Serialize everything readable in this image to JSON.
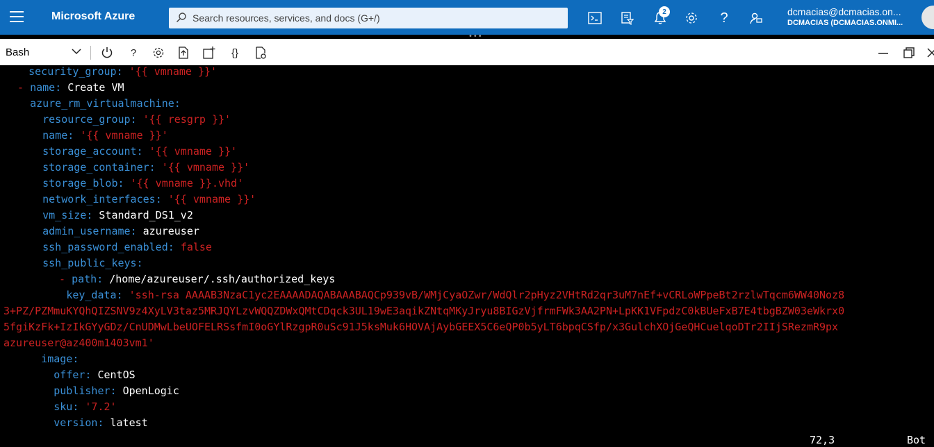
{
  "header": {
    "brand": "Microsoft Azure",
    "search_placeholder": "Search resources, services, and docs (G+/)",
    "notification_count": "2",
    "account_email": "dcmacias@dcmacias.on...",
    "account_directory": "DCMACIAS (DCMACIAS.ONMI..."
  },
  "shell": {
    "type": "Bash",
    "tools": {
      "help": "?",
      "braces": "{}"
    }
  },
  "terminal": {
    "l0": {
      "indent": "    ",
      "key": "security_group",
      "sep": ": ",
      "val": "'{{ vmname }}'"
    },
    "l1": {
      "dash": "- ",
      "key": "name",
      "sep": ": ",
      "val": "Create VM"
    },
    "l2": {
      "indent": "  ",
      "key": "azure_rm_virtualmachine",
      "sep": ":"
    },
    "l3": {
      "indent": "    ",
      "key": "resource_group",
      "sep": ": ",
      "val": "'{{ resgrp }}'"
    },
    "l4": {
      "indent": "    ",
      "key": "name",
      "sep": ": ",
      "val": "'{{ vmname }}'"
    },
    "l5": {
      "indent": "    ",
      "key": "storage_account",
      "sep": ": ",
      "val": "'{{ vmname }}'"
    },
    "l6": {
      "indent": "    ",
      "key": "storage_container",
      "sep": ": ",
      "val": "'{{ vmname }}'"
    },
    "l7": {
      "indent": "    ",
      "key": "storage_blob",
      "sep": ": ",
      "val": "'{{ vmname }}.vhd'"
    },
    "l8": {
      "indent": "    ",
      "key": "network_interfaces",
      "sep": ": ",
      "val": "'{{ vmname }}'"
    },
    "l9": {
      "indent": "    ",
      "key": "vm_size",
      "sep": ": ",
      "val": "Standard_DS1_v2"
    },
    "l10": {
      "indent": "    ",
      "key": "admin_username",
      "sep": ": ",
      "val": "azureuser"
    },
    "l11": {
      "indent": "    ",
      "key": "ssh_password_enabled",
      "sep": ": ",
      "val": "false"
    },
    "l12": {
      "indent": "    ",
      "key": "ssh_public_keys",
      "sep": ":"
    },
    "l13": {
      "dash": "- ",
      "key": "path",
      "sep": ": ",
      "val": "/home/azureuser/.ssh/authorized_keys"
    },
    "l14": {
      "indent": "          ",
      "key": "key_data",
      "sep": ": ",
      "val": "'ssh-rsa AAAAB3NzaC1yc2EAAAADAQABAAABAQCp939vB/WMjCyaOZwr/WdQlr2pHyz2VHtRd2qr3uM7nEf+vCRLoWPpeBt2rzlwTqcm6WW40Noz8"
    },
    "l15": "3+PZ/PZMmuKYQhQIZSNV9z4XyLV3taz5MRJQYLzvWQQZDWxQMtCDqck3UL19wE3aqikZNtqMKyJryu8BIGzVjfrmFWk3AA2PN+LpKK1VFpdzC0kBUeFxB7E4tbgBZW03eWkrx0",
    "l16": "5fgiKzFk+IzIkGYyGDz/CnUDMwLbeUOFELRSsfmI0oGYlRzgpR0uSc91J5ksMuk6HOVAjAybGEEX5C6eQP0b5yLT6bpqCSfp/x3GulchXOjGeQHCuelqoDTr2IIjSRezmR9px",
    "l17": "azureuser@az400m1403vm1'",
    "l18": {
      "indent": "      ",
      "key": "image",
      "sep": ":"
    },
    "l19": {
      "indent": "        ",
      "key": "offer",
      "sep": ": ",
      "val": "CentOS"
    },
    "l20": {
      "indent": "        ",
      "key": "publisher",
      "sep": ": ",
      "val": "OpenLogic"
    },
    "l21": {
      "indent": "        ",
      "key": "sku",
      "sep": ": ",
      "val": "'7.2'"
    },
    "l22": {
      "indent": "        ",
      "key": "version",
      "sep": ": ",
      "val": "latest"
    },
    "status_position": "72,3",
    "status_scroll": "Bot"
  }
}
